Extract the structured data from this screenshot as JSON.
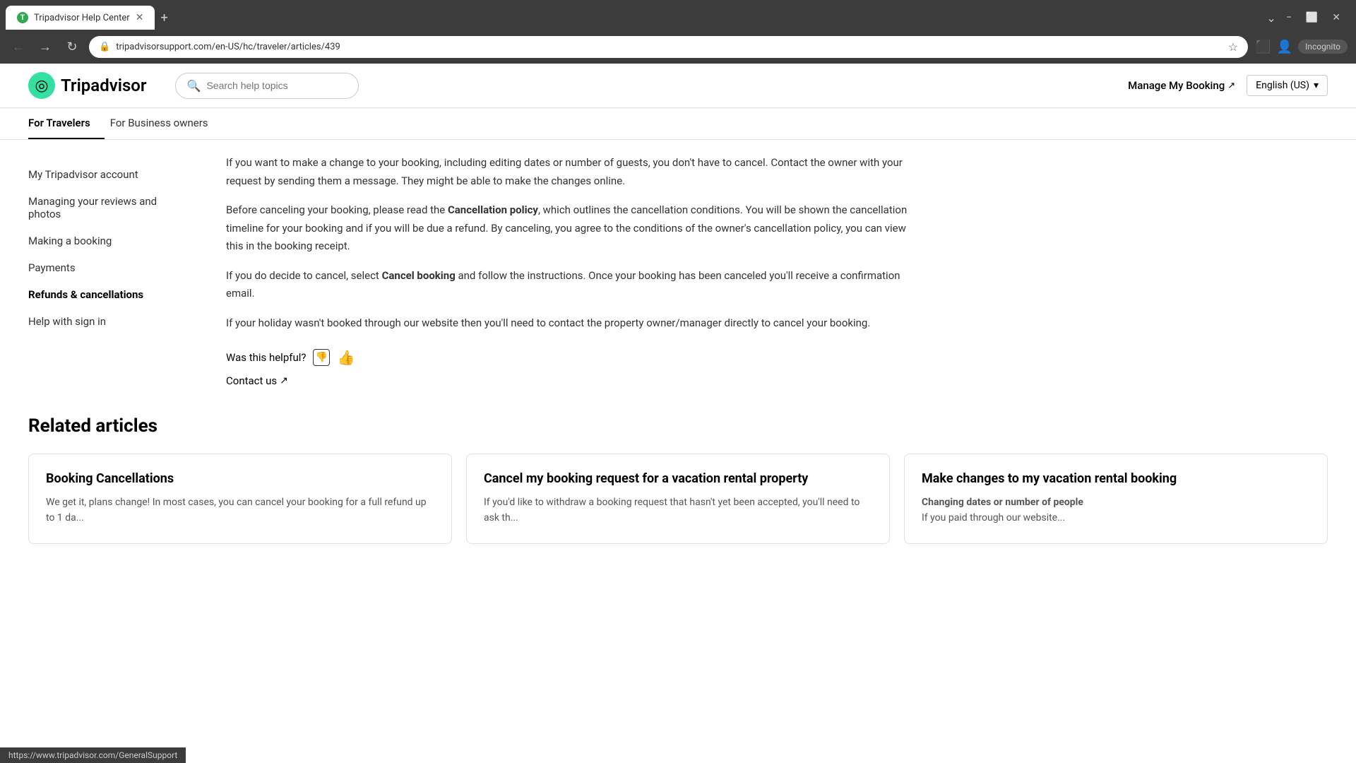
{
  "browser": {
    "tab_title": "Tripadvisor Help Center",
    "url": "tripadvisorsupport.com/en-US/hc/traveler/articles/439",
    "incognito_label": "Incognito"
  },
  "header": {
    "logo_text": "Tripadvisor",
    "search_placeholder": "Search help topics",
    "manage_booking": "Manage My Booking",
    "language": "English (US)"
  },
  "nav": {
    "tabs": [
      {
        "label": "For Travelers",
        "active": true
      },
      {
        "label": "For Business owners",
        "active": false
      }
    ]
  },
  "sidebar": {
    "items": [
      {
        "label": "My Tripadvisor account",
        "active": false
      },
      {
        "label": "Managing your reviews and photos",
        "active": false
      },
      {
        "label": "Making a booking",
        "active": false
      },
      {
        "label": "Payments",
        "active": false
      },
      {
        "label": "Refunds & cancellations",
        "active": true
      },
      {
        "label": "Help with sign in",
        "active": false
      }
    ]
  },
  "content": {
    "paragraphs": [
      "If you want to make a change to your booking, including editing dates or number of guests, you don't have to cancel. Contact the owner with your request by sending them a message. They might be able to make the changes online.",
      "Before canceling your booking, please read the [bold:Cancellation policy], which outlines the cancellation conditions. You will be shown the cancellation timeline for your booking and if you will be due a refund. By canceling, you agree to the conditions of the owner's cancellation policy, you can view this in the booking receipt.",
      "If you do decide to cancel, select [bold:Cancel booking] and follow the instructions. Once your booking has been canceled you'll receive a confirmation email.",
      "If your holiday wasn't booked through our website then you'll need to contact the property owner/manager directly to cancel your booking."
    ],
    "feedback_label": "Was this helpful?",
    "contact_label": "Contact us"
  },
  "related": {
    "title": "Related articles",
    "cards": [
      {
        "title": "Booking Cancellations",
        "excerpt": "We get it, plans change! In most cases, you can cancel your booking for a full refund up to 1 da..."
      },
      {
        "title": "Cancel my booking request for a vacation rental property",
        "excerpt": "If you'd like to withdraw a booking request that hasn't yet been accepted, you'll need to ask th..."
      },
      {
        "title": "Make changes to my vacation rental booking",
        "excerpt_bold": "Changing dates or number of people",
        "excerpt_extra": "If you paid through our website..."
      }
    ]
  },
  "status_bar": {
    "url": "https://www.tripadvisor.com/GeneralSupport"
  },
  "icons": {
    "back": "←",
    "forward": "→",
    "refresh": "↻",
    "lock": "🔒",
    "star": "☆",
    "extensions": "⬛",
    "minimize": "−",
    "maximize": "⬜",
    "close": "✕",
    "new_tab": "+",
    "external_link": "↗",
    "thumbdown": "👎",
    "thumbup": "👍",
    "chevron_down": "▾",
    "search": "🔍",
    "tab_down": "⌄",
    "account": "👤"
  }
}
